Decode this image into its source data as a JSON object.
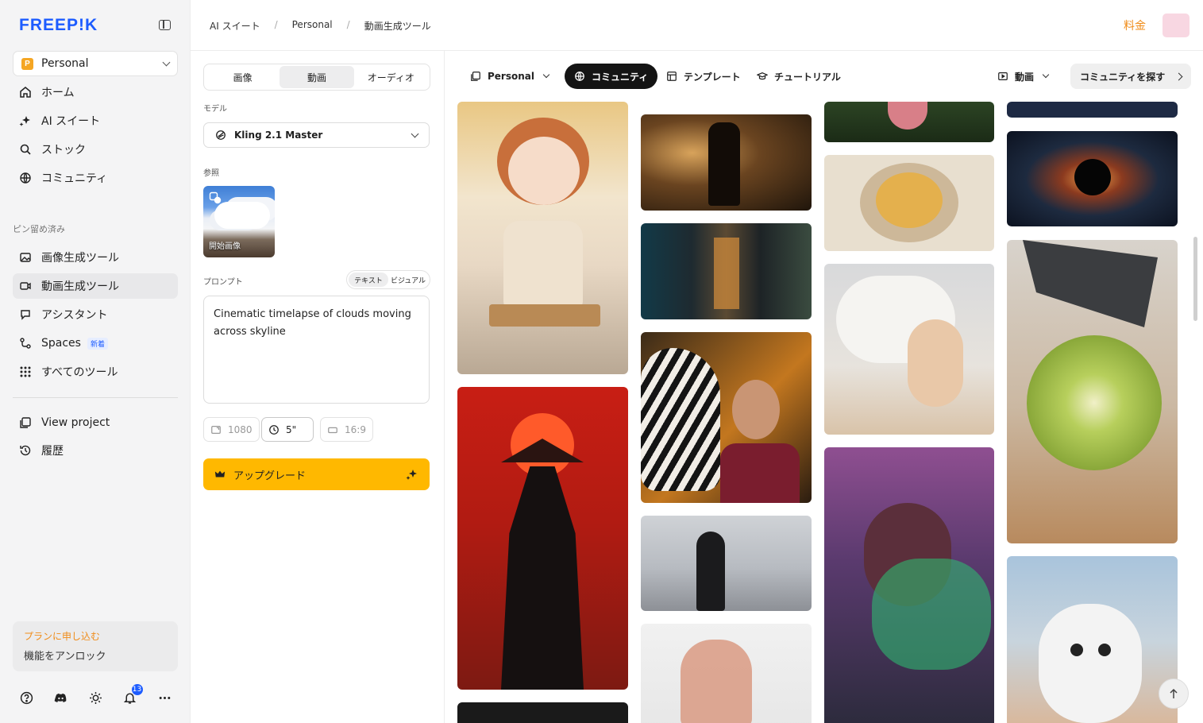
{
  "sidebar": {
    "logo": "FREEP!K",
    "workspace": {
      "badge": "P",
      "name": "Personal"
    },
    "nav": [
      {
        "label": "ホーム",
        "icon": "home-icon"
      },
      {
        "label": "AI スイート",
        "icon": "sparkle-icon"
      },
      {
        "label": "ストック",
        "icon": "search-icon"
      },
      {
        "label": "コミュニティ",
        "icon": "globe-icon"
      }
    ],
    "pinned_label": "ピン留め済み",
    "pinned": [
      {
        "label": "画像生成ツール",
        "icon": "image-icon"
      },
      {
        "label": "動画生成ツール",
        "icon": "video-icon"
      },
      {
        "label": "アシスタント",
        "icon": "assistant-icon"
      },
      {
        "label": "Spaces",
        "icon": "spaces-icon",
        "badge": "新着"
      },
      {
        "label": "すべてのツール",
        "icon": "grid-icon"
      }
    ],
    "extra": [
      {
        "label": "View project",
        "icon": "project-icon"
      },
      {
        "label": "履歴",
        "icon": "history-icon"
      }
    ],
    "plan": {
      "title": "プランに申し込む",
      "subtitle": "機能をアンロック"
    },
    "notifications_count": "13"
  },
  "header": {
    "breadcrumbs": [
      "AI スイート",
      "Personal",
      "動画生成ツール"
    ],
    "pricing": "料金"
  },
  "panel": {
    "tabs": [
      "画像",
      "動画",
      "オーディオ"
    ],
    "active_tab": "動画",
    "model_label": "モデル",
    "model_value": "Kling 2.1 Master",
    "reference_label": "参照",
    "reference_caption": "開始画像",
    "prompt_label": "プロンプト",
    "prompt_modes": [
      "テキスト",
      "ビジュアル"
    ],
    "prompt_text": "Cinematic timelapse of clouds moving across skyline",
    "options": {
      "resolution": "1080",
      "duration": "5\"",
      "ratio": "16:9"
    },
    "upgrade_label": "アップグレード"
  },
  "gallery_header": {
    "scope": "Personal",
    "community": "コミュニティ",
    "templates": "テンプレート",
    "tutorials": "チュートリアル",
    "media_type": "動画",
    "explore": "コミュニティを探す"
  },
  "colors": {
    "brand": "#1d5cff",
    "accent_orange": "#f08c19",
    "upgrade": "#ffb800"
  }
}
